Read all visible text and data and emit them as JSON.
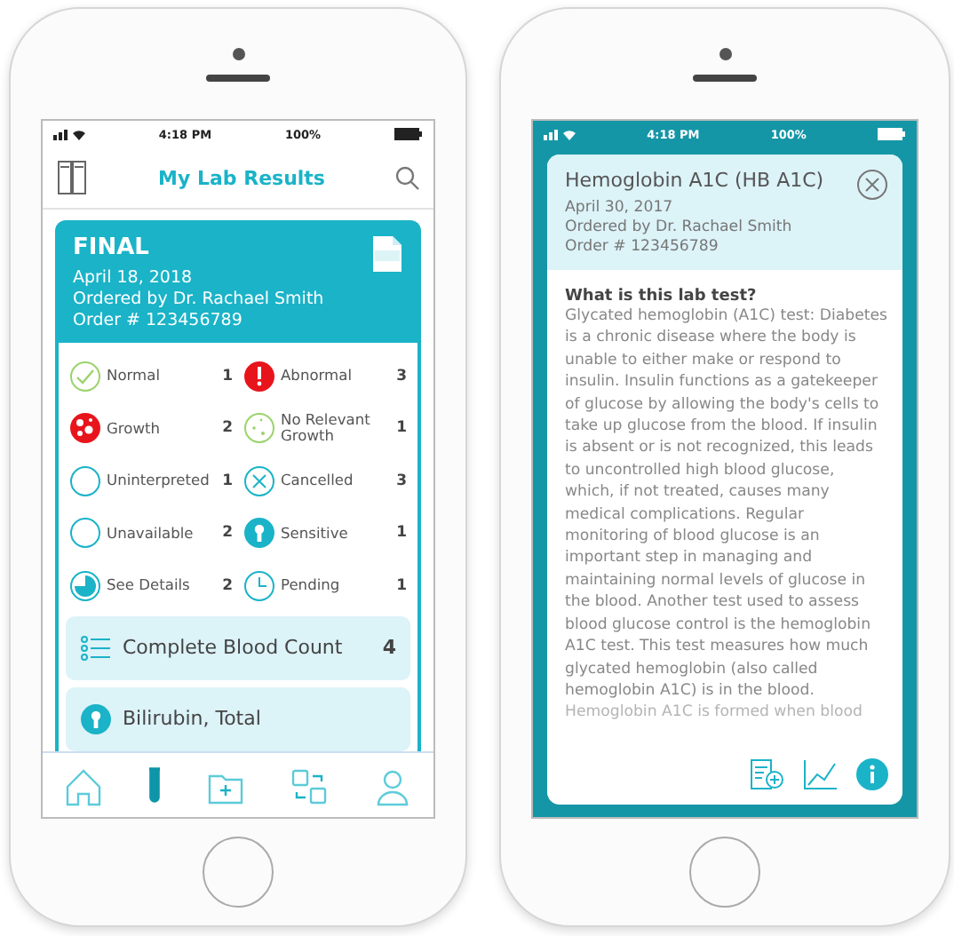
{
  "left_phone": {
    "status_bar": {
      "time": "4:18 PM",
      "battery": "100%"
    },
    "header": {
      "title": "My Lab Results"
    },
    "result": {
      "status": "FINAL",
      "date": "April 18, 2018",
      "ordered_by": "Ordered by Dr. Rachael Smith",
      "order": "Order # 123456789"
    },
    "legend": [
      {
        "kind": "normal",
        "label": "Normal",
        "count": "1"
      },
      {
        "kind": "abnormal",
        "label": "Abnormal",
        "count": "3"
      },
      {
        "kind": "growth",
        "label": "Growth",
        "count": "2"
      },
      {
        "kind": "no-growth",
        "label": "No Relevant Growth",
        "count": "1"
      },
      {
        "kind": "empty",
        "label": "Uninterpreted",
        "count": "1"
      },
      {
        "kind": "cancelled",
        "label": "Cancelled",
        "count": "3"
      },
      {
        "kind": "empty",
        "label": "Unavailable",
        "count": "2"
      },
      {
        "kind": "sensitive",
        "label": "Sensitive",
        "count": "1"
      },
      {
        "kind": "details",
        "label": "See Details",
        "count": "2"
      },
      {
        "kind": "pending",
        "label": "Pending",
        "count": "1"
      }
    ],
    "tests": [
      {
        "kind": "list",
        "name": "Complete Blood Count",
        "count": "4"
      },
      {
        "kind": "sensitive",
        "name": "Bilirubin, Total"
      }
    ],
    "nav": [
      {
        "kind": "home",
        "selected": false
      },
      {
        "kind": "tube",
        "selected": true
      },
      {
        "kind": "folder",
        "selected": false
      },
      {
        "kind": "swap",
        "selected": false
      },
      {
        "kind": "person",
        "selected": false
      }
    ]
  },
  "right_phone": {
    "status_bar": {
      "time": "4:18 PM",
      "battery": "100%"
    },
    "detail": {
      "title": "Hemoglobin A1C (HB A1C)",
      "date": "April 30, 2017",
      "ordered_by": "Ordered by Dr. Rachael Smith",
      "order": "Order # 123456789",
      "question": "What is this lab test?",
      "body": "Glycated hemoglobin (A1C) test: Diabetes is a chronic disease where the body is unable to either make or respond to insulin. Insulin functions as a gatekeeper of glucose by allowing the body's cells to take up glucose from the blood. If insulin is absent or is not recognized, this leads to uncontrolled high blood glucose, which, if not treated, causes many medical complications. Regular monitoring of blood glucose is an important step in managing and maintaining normal levels of glucose in the blood. Another test used to assess blood glucose control is the hemoglobin A1C test. This test measures how much glycated hemoglobin (also called hemoglobin A1C) is in the blood.",
      "faded_line": "Hemoglobin A1C is formed when blood"
    }
  }
}
